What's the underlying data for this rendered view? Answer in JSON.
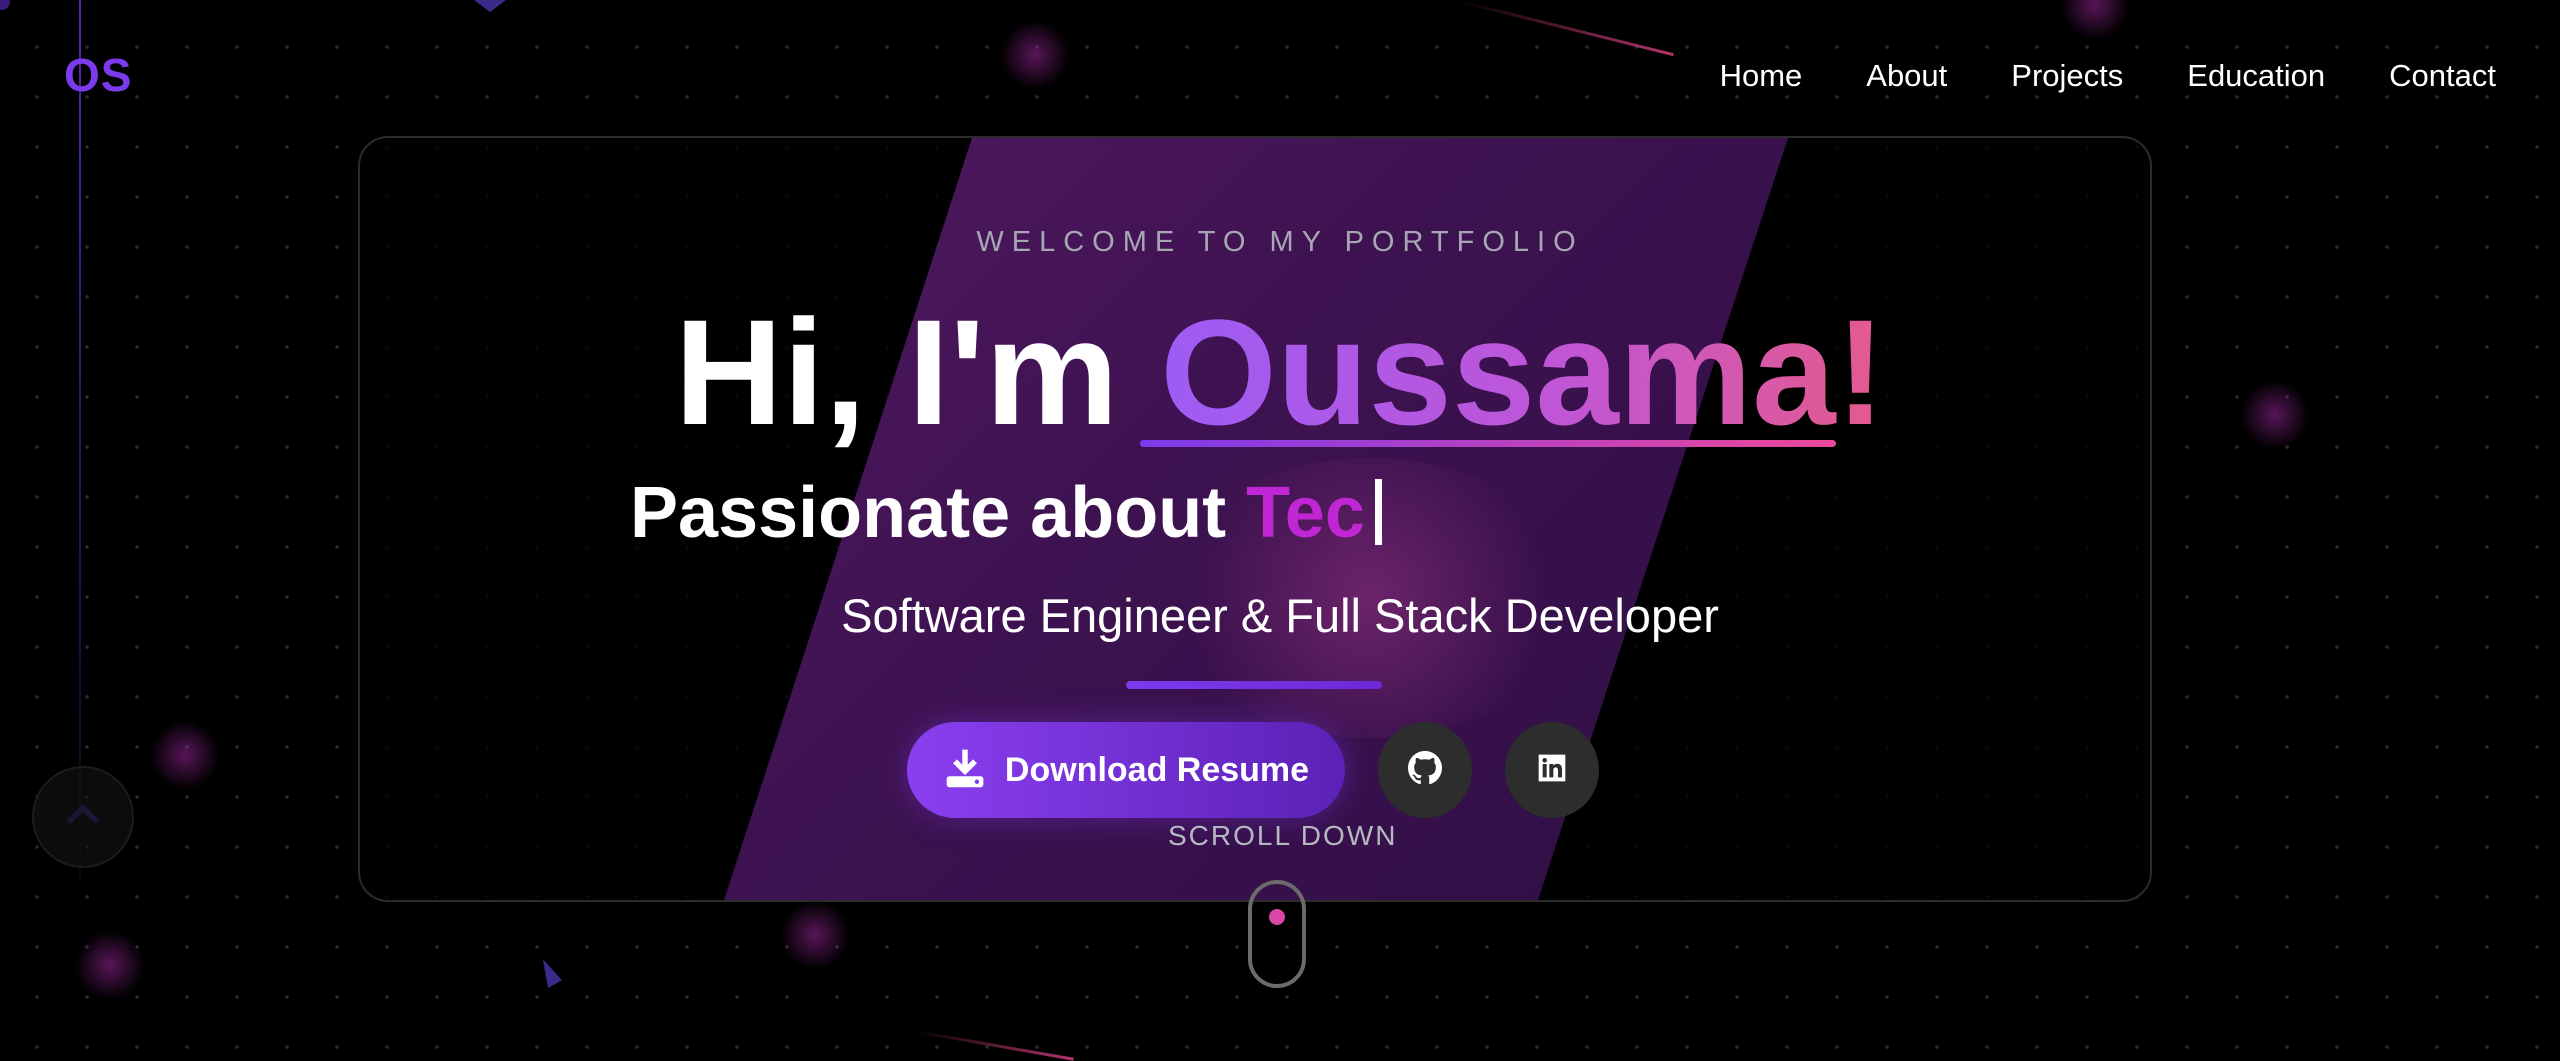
{
  "logo": "OS",
  "nav": {
    "items": [
      "Home",
      "About",
      "Projects",
      "Education",
      "Contact"
    ]
  },
  "hero": {
    "eyebrow": "WELCOME TO MY PORTFOLIO",
    "greeting": "Hi, I'm ",
    "name": "Oussama!",
    "tagline_prefix": "Passionate about ",
    "tagline_word": "Tec",
    "subtitle": "Software Engineer & Full Stack Developer",
    "resume_button": "Download Resume",
    "scroll_label": "SCROLL DOWN"
  },
  "icons": {
    "download": "download-icon",
    "github": "github-icon",
    "linkedin": "linkedin-icon",
    "back_to_top": "chevron-up-icon"
  },
  "colors": {
    "accent": "#7c3aed",
    "pink": "#ec4899",
    "magenta": "#c026d3",
    "background": "#000000"
  }
}
